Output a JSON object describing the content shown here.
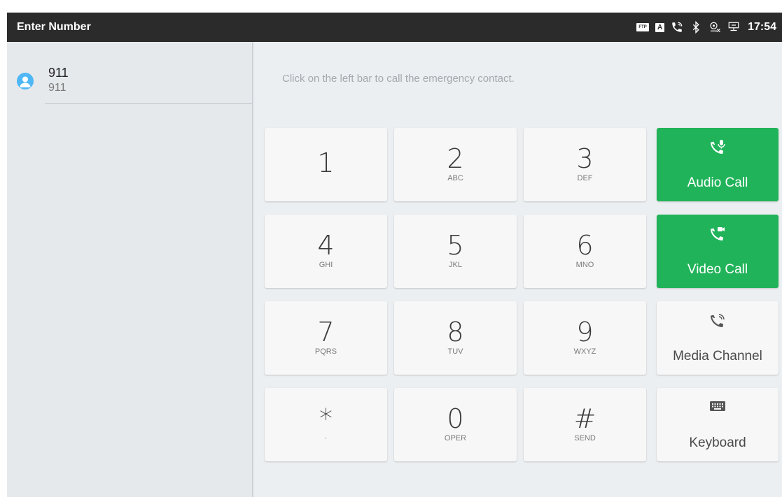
{
  "statusbar": {
    "title": "Enter Number",
    "ftp_badge": "FTP",
    "a_badge": "A",
    "time": "17:54",
    "icons": [
      "ftp-icon",
      "a-icon",
      "call-icon",
      "bluetooth-icon",
      "camera-off-icon",
      "network-icon"
    ]
  },
  "contact": {
    "name": "911",
    "number": "911",
    "avatar_color": "#4fb7f5"
  },
  "hint": "Click on the left bar to call the emergency contact.",
  "keypad": [
    {
      "digit": "1",
      "letters": ""
    },
    {
      "digit": "2",
      "letters": "ABC"
    },
    {
      "digit": "3",
      "letters": "DEF"
    },
    {
      "digit": "4",
      "letters": "GHI"
    },
    {
      "digit": "5",
      "letters": "JKL"
    },
    {
      "digit": "6",
      "letters": "MNO"
    },
    {
      "digit": "7",
      "letters": "PQRS"
    },
    {
      "digit": "8",
      "letters": "TUV"
    },
    {
      "digit": "9",
      "letters": "WXYZ"
    },
    {
      "digit": "*",
      "letters": "·"
    },
    {
      "digit": "0",
      "letters": "OPER"
    },
    {
      "digit": "#",
      "letters": "SEND"
    }
  ],
  "actions": {
    "audio_call": "Audio Call",
    "video_call": "Video Call",
    "media_channel": "Media Channel",
    "keyboard": "Keyboard"
  },
  "colors": {
    "accent_green": "#21b35a",
    "statusbar": "#2b2b2b"
  }
}
